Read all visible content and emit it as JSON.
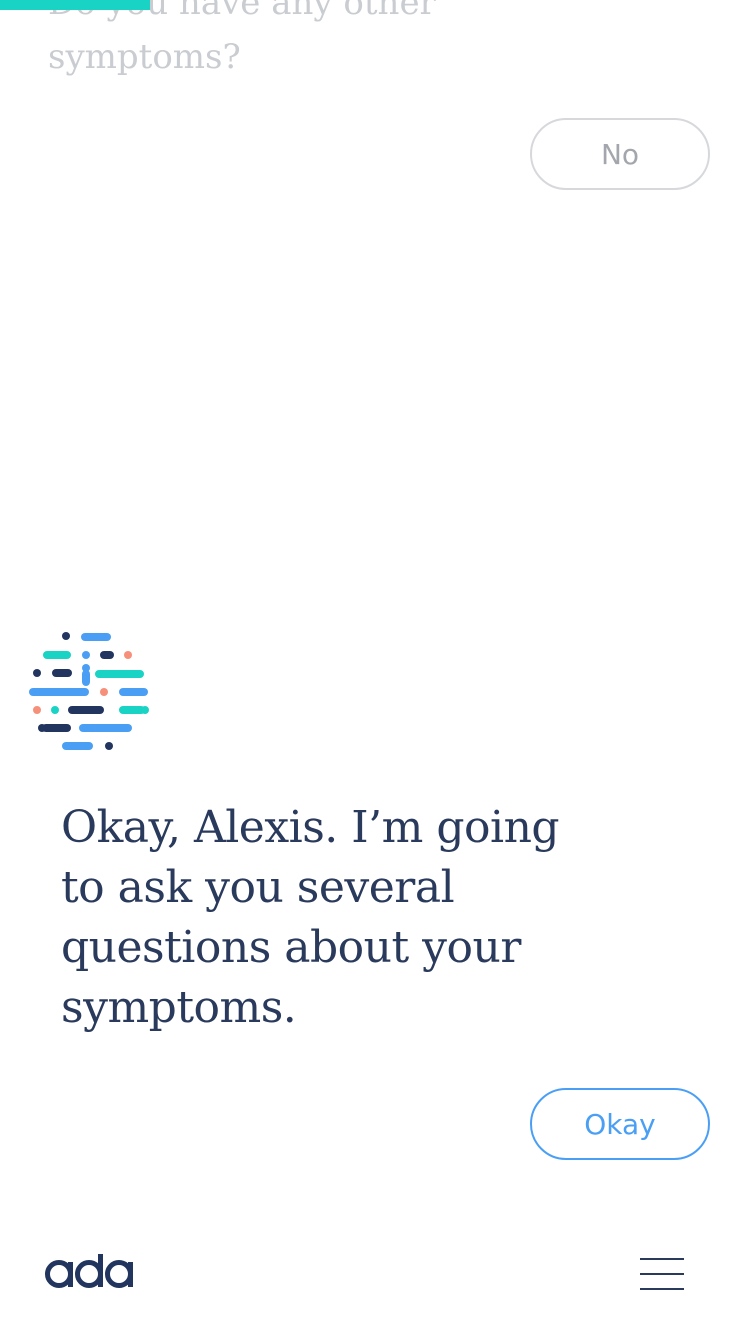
{
  "progress": {
    "fraction": 0.2,
    "color": "#19d3c5"
  },
  "previous_question": {
    "text": "Do you have any other symptoms?",
    "answer_label": "No"
  },
  "current_message": {
    "text": "Okay, Alexis. I’m going to ask you several questions about your symptoms.",
    "reply_label": "Okay"
  },
  "footer": {
    "logo_text": "ada",
    "menu_icon": "hamburger-menu-icon"
  },
  "colors": {
    "text_dark": "#2a3a5c",
    "text_faded": "#c9ccd1",
    "accent_blue": "#4a9ff5",
    "accent_teal": "#19d3c5",
    "accent_coral": "#f7907a",
    "navy": "#22355e"
  }
}
